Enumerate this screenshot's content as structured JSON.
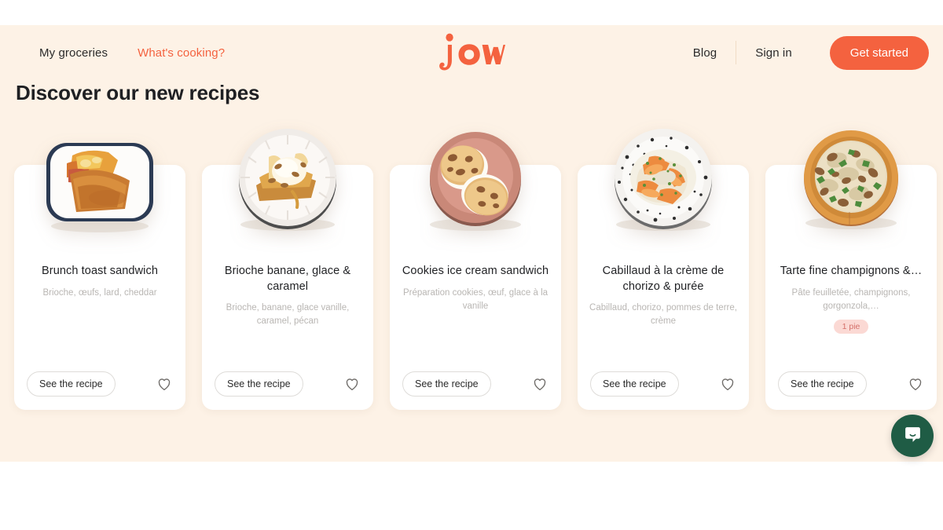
{
  "brand": {
    "logo_text": "jow",
    "accent_color": "#f4623f",
    "background_color": "#fdf2e6"
  },
  "header": {
    "nav_left": [
      {
        "label": "My groceries",
        "active": false
      },
      {
        "label": "What's cooking?",
        "active": true
      }
    ],
    "nav_right": [
      {
        "label": "Blog"
      },
      {
        "label": "Sign in"
      }
    ],
    "cta_label": "Get started"
  },
  "main": {
    "section_title": "Discover our new recipes",
    "see_recipe_label": "See the recipe",
    "cards": [
      {
        "title": "Brunch toast sandwich",
        "subtitle": "Brioche, œufs, lard, cheddar",
        "badge": "",
        "image_name": "brunch-toast-sandwich-photo"
      },
      {
        "title": "Brioche banane, glace & caramel",
        "subtitle": "Brioche, banane, glace vanille, caramel, pécan",
        "badge": "",
        "image_name": "brioche-banane-glace-caramel-photo"
      },
      {
        "title": "Cookies ice cream sandwich",
        "subtitle": "Préparation cookies, œuf, glace à la vanille",
        "badge": "",
        "image_name": "cookies-ice-cream-sandwich-photo"
      },
      {
        "title": "Cabillaud à la crème de chorizo & purée",
        "subtitle": "Cabillaud, chorizo, pommes de terre, crème",
        "badge": "",
        "image_name": "cabillaud-creme-chorizo-puree-photo"
      },
      {
        "title": "Tarte fine champignons &…",
        "subtitle": "Pâte feuilletée, champignons, gorgonzola,…",
        "badge": "1 pie",
        "image_name": "tarte-fine-champignons-photo"
      }
    ]
  },
  "chat": {
    "icon": "message-bubble-icon",
    "color": "#1f5c45"
  }
}
